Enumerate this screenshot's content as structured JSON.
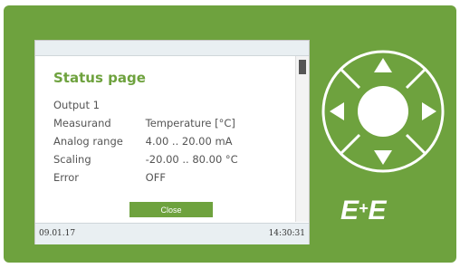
{
  "screen": {
    "title": "Status page",
    "rows": [
      {
        "key": "Output 1",
        "value": ""
      },
      {
        "key": "Measurand",
        "value": "Temperature [°C]"
      },
      {
        "key": "Analog range",
        "value": "4.00 .. 20.00 mA"
      },
      {
        "key": "Scaling",
        "value": "-20.00 .. 80.00 °C"
      },
      {
        "key": "Error",
        "value": "OFF"
      }
    ],
    "close_label": "Close",
    "date": "09.01.17",
    "time": "14:30:31"
  },
  "brand": {
    "left": "E",
    "plus": "+",
    "right": "E"
  },
  "colors": {
    "accent": "#6ea23e",
    "device_body": "#6ea23e",
    "screen_bars": "#e9eff2"
  },
  "icons": [
    "arrow-up-icon",
    "arrow-down-icon",
    "arrow-left-icon",
    "arrow-right-icon",
    "center-button-icon"
  ]
}
